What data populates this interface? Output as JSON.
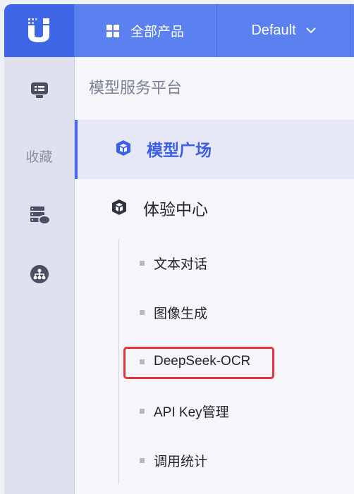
{
  "header": {
    "all_products_label": "全部产品",
    "project_selector_label": "Default"
  },
  "rail": {
    "favorites_label": "收藏"
  },
  "panel": {
    "title": "模型服务平台",
    "menu": [
      {
        "label": "模型广场",
        "active": true
      },
      {
        "label": "体验中心",
        "active": false
      }
    ],
    "submenu": [
      {
        "label": "文本对话"
      },
      {
        "label": "图像生成"
      },
      {
        "label": "DeepSeek-OCR"
      },
      {
        "label": "API Key管理"
      },
      {
        "label": "调用统计"
      }
    ]
  },
  "colors": {
    "brand": "#3f66e6",
    "header": "#5b80f0",
    "active_text": "#3c5fe6",
    "highlight": "#e5333a"
  },
  "icons": [
    "u-logo",
    "grid-icon",
    "chevron-down-icon",
    "monitor-icon",
    "server-cloud-icon",
    "network-icon",
    "cube-icon"
  ]
}
